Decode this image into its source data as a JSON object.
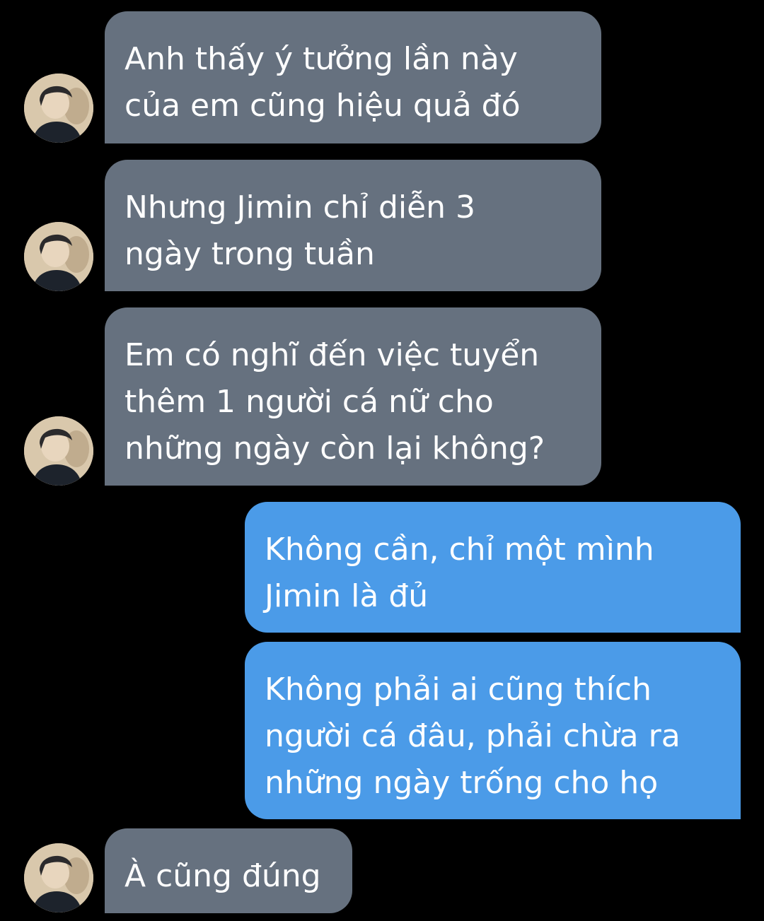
{
  "colors": {
    "background": "#000000",
    "incoming_bubble": "#66717f",
    "outgoing_bubble": "#4b9be8",
    "text": "#ffffff"
  },
  "messages": [
    {
      "sender": "other",
      "lines": [
        "Anh thấy ý tưởng lần này",
        "của em cũng hiệu quả đó"
      ],
      "avatar_icon": "contact-avatar-icon"
    },
    {
      "sender": "other",
      "lines": [
        "Nhưng Jimin chỉ diễn 3",
        "ngày trong tuần"
      ],
      "avatar_icon": "contact-avatar-icon"
    },
    {
      "sender": "other",
      "lines": [
        "Em có nghĩ đến việc tuyển",
        "thêm 1 người cá nữ cho",
        "những ngày còn lại không?"
      ],
      "avatar_icon": "contact-avatar-icon"
    },
    {
      "sender": "me",
      "lines": [
        "Không cần, chỉ một mình",
        "Jimin là đủ"
      ]
    },
    {
      "sender": "me",
      "lines": [
        "Không phải ai cũng thích",
        "người cá đâu, phải chừa ra",
        "những ngày trống cho họ"
      ]
    },
    {
      "sender": "other",
      "lines": [
        "À cũng đúng"
      ],
      "avatar_icon": "contact-avatar-icon"
    }
  ]
}
